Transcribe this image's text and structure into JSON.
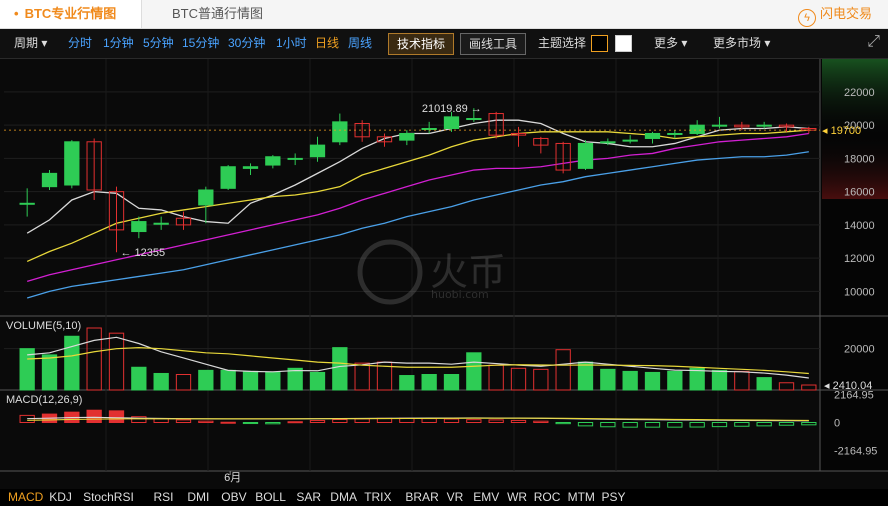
{
  "tabs": {
    "active": "BTC专业行情图",
    "inactive": "BTC普通行情图"
  },
  "brand": {
    "label": "闪电交易"
  },
  "toolbar": {
    "period": "周期",
    "intervals": [
      "分时",
      "1分钟",
      "5分钟",
      "15分钟",
      "30分钟",
      "1小时",
      "日线",
      "周线"
    ],
    "active_interval": "日线",
    "indicator_btn": "技术指标",
    "drawing_btn": "画线工具",
    "theme_label": "主题选择",
    "more": "更多",
    "more_markets": "更多市场"
  },
  "colors": {
    "up": "#2ecc55",
    "down": "#e23030",
    "ma5": "#d9d9d9",
    "ma10": "#e8d83a",
    "ma20": "#d21fd2",
    "ma30": "#4aa0e8",
    "accent": "#f0a020"
  },
  "main_labels": {
    "high": "21019.89",
    "low": "12355",
    "price": "19700",
    "month": "6月"
  },
  "volume_labels": {
    "title": "VOLUME(5,10)",
    "last": "2410.04"
  },
  "macd_labels": {
    "title": "MACD(12,26,9)"
  },
  "watermark": {
    "cn": "火币",
    "en": "huobi.com"
  },
  "indicators": [
    "MACD",
    "KDJ",
    "StochRSI",
    "RSI",
    "DMI",
    "OBV",
    "BOLL",
    "SAR",
    "DMA",
    "TRIX",
    "BRAR",
    "VR",
    "EMV",
    "WR",
    "ROC",
    "MTM",
    "PSY"
  ],
  "chart_data": [
    {
      "type": "candlestick",
      "title": "",
      "ylim": [
        9000,
        23500
      ],
      "yticks": [
        10000,
        12000,
        14000,
        16000,
        18000,
        20000,
        22000
      ],
      "candles": [
        {
          "o": 15300,
          "c": 15300,
          "h": 16200,
          "l": 14500
        },
        {
          "o": 16300,
          "c": 17100,
          "h": 17300,
          "l": 16100
        },
        {
          "o": 16400,
          "c": 19000,
          "h": 19100,
          "l": 16200
        },
        {
          "o": 19000,
          "c": 16100,
          "h": 19200,
          "l": 15500
        },
        {
          "o": 16000,
          "c": 13700,
          "h": 16300,
          "l": 12355
        },
        {
          "o": 13600,
          "c": 14200,
          "h": 14500,
          "l": 13200
        },
        {
          "o": 14100,
          "c": 14100,
          "h": 14500,
          "l": 13700
        },
        {
          "o": 14400,
          "c": 14000,
          "h": 14800,
          "l": 13700
        },
        {
          "o": 15200,
          "c": 16100,
          "h": 16300,
          "l": 14100
        },
        {
          "o": 16200,
          "c": 17500,
          "h": 17600,
          "l": 16100
        },
        {
          "o": 17400,
          "c": 17500,
          "h": 17700,
          "l": 17000
        },
        {
          "o": 17600,
          "c": 18100,
          "h": 18200,
          "l": 17400
        },
        {
          "o": 18000,
          "c": 18000,
          "h": 18300,
          "l": 17600
        },
        {
          "o": 18100,
          "c": 18800,
          "h": 19300,
          "l": 17800
        },
        {
          "o": 19000,
          "c": 20200,
          "h": 20700,
          "l": 18800
        },
        {
          "o": 20100,
          "c": 19300,
          "h": 20300,
          "l": 19000
        },
        {
          "o": 19300,
          "c": 19000,
          "h": 19500,
          "l": 18700
        },
        {
          "o": 19100,
          "c": 19500,
          "h": 19700,
          "l": 18800
        },
        {
          "o": 19800,
          "c": 19800,
          "h": 20200,
          "l": 19500
        },
        {
          "o": 19800,
          "c": 20500,
          "h": 20800,
          "l": 19600
        },
        {
          "o": 20400,
          "c": 20400,
          "h": 21019.89,
          "l": 20200
        },
        {
          "o": 20700,
          "c": 19400,
          "h": 20800,
          "l": 19200
        },
        {
          "o": 19500,
          "c": 19400,
          "h": 19900,
          "l": 18700
        },
        {
          "o": 19200,
          "c": 18800,
          "h": 19300,
          "l": 18300
        },
        {
          "o": 18900,
          "c": 17300,
          "h": 19000,
          "l": 17100
        },
        {
          "o": 17400,
          "c": 18900,
          "h": 19100,
          "l": 17300
        },
        {
          "o": 19000,
          "c": 19000,
          "h": 19200,
          "l": 18800
        },
        {
          "o": 19100,
          "c": 19100,
          "h": 19400,
          "l": 18900
        },
        {
          "o": 19200,
          "c": 19500,
          "h": 19600,
          "l": 18900
        },
        {
          "o": 19500,
          "c": 19500,
          "h": 19700,
          "l": 19200
        },
        {
          "o": 19500,
          "c": 20000,
          "h": 20300,
          "l": 19400
        },
        {
          "o": 20000,
          "c": 20000,
          "h": 20500,
          "l": 19800
        },
        {
          "o": 20000,
          "c": 19900,
          "h": 20200,
          "l": 19700
        },
        {
          "o": 20000,
          "c": 20000,
          "h": 20200,
          "l": 19800
        },
        {
          "o": 20000,
          "c": 19900,
          "h": 20100,
          "l": 19600
        },
        {
          "o": 19800,
          "c": 19700,
          "h": 19900,
          "l": 19500
        }
      ],
      "series": [
        {
          "name": "MA5",
          "values": [
            13500,
            14300,
            15500,
            16000,
            15900,
            15000,
            14900,
            14500,
            14200,
            14100,
            15300,
            15800,
            16400,
            17100,
            17800,
            18600,
            19200,
            19500,
            19500,
            19800,
            20100,
            20300,
            20300,
            20100,
            19500,
            19000,
            18900,
            18700,
            18700,
            18900,
            19300,
            19700,
            19800,
            19800,
            19900,
            19800
          ]
        },
        {
          "name": "MA10",
          "values": [
            11800,
            12400,
            12900,
            13500,
            14100,
            14400,
            14700,
            14900,
            15100,
            15300,
            15500,
            15700,
            15800,
            16000,
            16300,
            17000,
            17400,
            17800,
            18200,
            18700,
            19100,
            19300,
            19500,
            19600,
            19600,
            19600,
            19600,
            19500,
            19400,
            19200,
            19300,
            19400,
            19500,
            19500,
            19600,
            19700
          ]
        },
        {
          "name": "MA20",
          "values": [
            10600,
            11000,
            11300,
            11600,
            11900,
            12200,
            12500,
            12800,
            13100,
            13400,
            13700,
            14000,
            14300,
            14600,
            15000,
            15500,
            15900,
            16300,
            16700,
            17000,
            17300,
            17400,
            17400,
            17500,
            17700,
            17900,
            18000,
            18200,
            18300,
            18600,
            18800,
            19000,
            19100,
            19200,
            19300,
            19500
          ]
        },
        {
          "name": "MA30",
          "values": [
            9600,
            10000,
            10300,
            10500,
            10700,
            10900,
            11100,
            11300,
            11600,
            11900,
            12200,
            12500,
            12800,
            13100,
            13400,
            13800,
            14100,
            14500,
            14800,
            15100,
            15500,
            15800,
            16100,
            16400,
            16600,
            16900,
            17100,
            17300,
            17500,
            17700,
            17900,
            18000,
            18100,
            18100,
            18200,
            18400
          ]
        }
      ]
    },
    {
      "type": "bar",
      "title": "VOLUME(5,10)",
      "ylim": [
        0,
        30000
      ],
      "yticks": [
        20000
      ],
      "values": [
        20000,
        17000,
        26000,
        30000,
        27500,
        11000,
        8000,
        7500,
        9500,
        9500,
        9000,
        8500,
        10500,
        8500,
        20500,
        13000,
        13500,
        7000,
        7500,
        7500,
        18000,
        12000,
        10500,
        10000,
        19500,
        13500,
        10000,
        9000,
        8500,
        9000,
        10500,
        9500,
        9000,
        6000,
        3500,
        2410.04
      ],
      "series": [
        {
          "name": "MA5",
          "values": [
            17000,
            18000,
            21000,
            24000,
            25500,
            22500,
            18500,
            15500,
            12500,
            9500,
            9000,
            8800,
            9400,
            9300,
            11400,
            12200,
            13500,
            13000,
            13000,
            12500,
            13500,
            12800,
            12000,
            11500,
            12500,
            13500,
            12500,
            11500,
            10500,
            9600,
            9400,
            9000,
            8800,
            8200,
            7200,
            5800
          ]
        },
        {
          "name": "MA10",
          "values": [
            15000,
            15500,
            16500,
            18500,
            20000,
            20500,
            20000,
            19000,
            18000,
            17500,
            16500,
            15500,
            14500,
            13500,
            13000,
            12000,
            11500,
            11000,
            11000,
            11000,
            11500,
            12000,
            12200,
            12100,
            12000,
            12100,
            12000,
            11900,
            11800,
            11500,
            11000,
            10500,
            10000,
            9500,
            8800,
            8000
          ]
        }
      ]
    },
    {
      "type": "bar",
      "title": "MACD(12,26,9)",
      "ylim": [
        -2164.95,
        2164.95
      ],
      "yticks": [
        2164.95,
        0,
        -2164.95
      ],
      "values": [
        550,
        650,
        800,
        950,
        900,
        450,
        300,
        200,
        100,
        20,
        -80,
        -100,
        60,
        150,
        230,
        280,
        320,
        330,
        300,
        270,
        220,
        200,
        160,
        100,
        -90,
        -260,
        -330,
        -360,
        -360,
        -360,
        -350,
        -320,
        -290,
        -260,
        -210,
        -180
      ],
      "series": [
        {
          "name": "DIF",
          "values": [
            900,
            1000,
            1150,
            1200,
            1100,
            1000,
            950,
            900,
            850,
            820,
            820,
            830,
            850,
            880,
            920,
            950,
            980,
            1000,
            1020,
            1040,
            1050,
            1040,
            1020,
            980,
            900,
            820,
            750,
            700,
            650,
            600,
            560,
            520,
            480,
            450,
            420,
            380
          ]
        },
        {
          "name": "DEA",
          "values": [
            500,
            600,
            700,
            780,
            830,
            850,
            860,
            860,
            860,
            860,
            860,
            860,
            860,
            870,
            880,
            890,
            910,
            930,
            950,
            970,
            990,
            1000,
            1000,
            990,
            960,
            910,
            860,
            810,
            770,
            720,
            680,
            640,
            600,
            560,
            520,
            480
          ]
        }
      ]
    }
  ]
}
